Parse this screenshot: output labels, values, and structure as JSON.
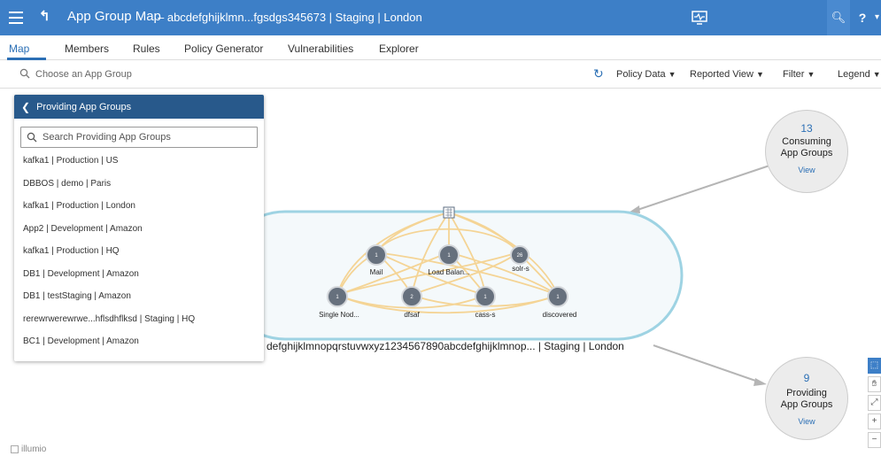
{
  "header": {
    "title": "App Group Map",
    "subtitle": "–  abcdefghijklmn...fgsdgs345673 | Staging | London"
  },
  "tabs": [
    {
      "label": "Map"
    },
    {
      "label": "Members"
    },
    {
      "label": "Rules"
    },
    {
      "label": "Policy Generator"
    },
    {
      "label": "Vulnerabilities"
    },
    {
      "label": "Explorer"
    }
  ],
  "toolbar": {
    "search_placeholder": "Choose an App Group",
    "policy_data": "Policy Data",
    "reported_view": "Reported View",
    "filter": "Filter",
    "legend": "Legend"
  },
  "panel": {
    "title": "Providing App Groups",
    "search_placeholder": "Search Providing App Groups",
    "items": [
      "kafka1 | Production | US",
      "DBBOS | demo | Paris",
      "kafka1 | Production | London",
      "App2 | Development | Amazon",
      "kafka1 | Production | HQ",
      "DB1 | Development | Amazon",
      "DB1 | testStaging | Amazon",
      "rerewrwerewrwe...hflsdhflksd | Staging | HQ",
      "BC1 | Development | Amazon"
    ]
  },
  "consuming": {
    "count": "13",
    "label1": "Consuming",
    "label2": "App Groups",
    "view": "View"
  },
  "providing": {
    "count": "9",
    "label1": "Providing",
    "label2": "App Groups",
    "view": "View"
  },
  "group_label": "defghijklmnopqrstuvwxyz1234567890abcdefghijklmnop... | Staging | London",
  "nodes": [
    {
      "count": "1",
      "label": "Mail"
    },
    {
      "count": "1",
      "label": "Load Balan..."
    },
    {
      "count": "26",
      "label": "solr-s"
    },
    {
      "count": "1",
      "label": "Single Nod..."
    },
    {
      "count": "2",
      "label": "dfsaf"
    },
    {
      "count": "1",
      "label": "cass-s"
    },
    {
      "count": "1",
      "label": "discovered"
    }
  ],
  "side_tools": [
    "select-tool",
    "pan-tool",
    "fit-tool",
    "zoom-in",
    "zoom-out"
  ],
  "logo": "illumio",
  "colors": {
    "header": "#3d7fc7",
    "panel_head": "#28598b",
    "edge": "#f5d08a",
    "node": "#66707d"
  }
}
